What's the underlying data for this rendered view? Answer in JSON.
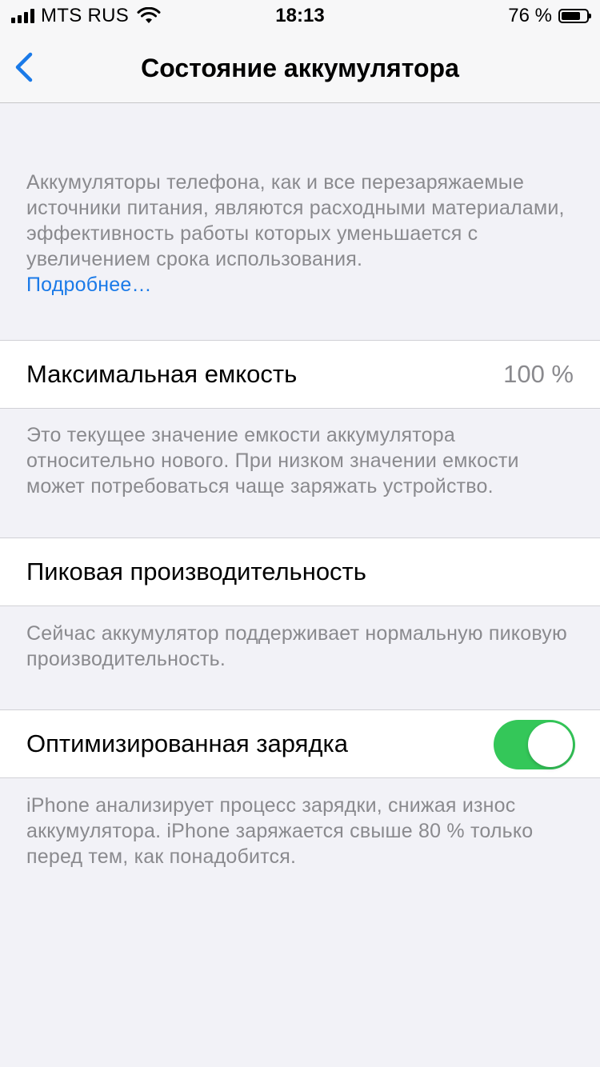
{
  "status_bar": {
    "carrier": "MTS RUS",
    "time": "18:13",
    "battery_percent": "76 %",
    "battery_level": 0.76,
    "icons": [
      "signal-icon",
      "wifi-icon",
      "battery-icon"
    ]
  },
  "nav": {
    "title": "Состояние аккумулятора",
    "back_icon": "chevron-left-icon"
  },
  "intro": {
    "text": "Аккумуляторы телефона, как и все перезаряжаемые источники питания, являются расходными материалами, эффективность работы которых уменьшается с увеличением срока использования.",
    "link": "Подробнее…"
  },
  "max_capacity": {
    "label": "Максимальная емкость",
    "value": "100 %",
    "footer": "Это текущее значение емкости аккумулятора относительно нового. При низком значении емкости может потребоваться чаще заряжать устройство."
  },
  "peak_performance": {
    "label": "Пиковая производительность",
    "footer": "Сейчас аккумулятор поддерживает нормальную пиковую производительность."
  },
  "optimized_charging": {
    "label": "Оптимизированная зарядка",
    "enabled": true,
    "footer": "iPhone анализирует процесс зарядки, снижая износ аккумулятора. iPhone заряжается свыше 80 % только перед тем, как понадобится."
  },
  "colors": {
    "accent": "#1A7AE8",
    "toggle_on": "#34C759",
    "background": "#F2F2F7",
    "secondary_text": "#8A8A8E"
  }
}
